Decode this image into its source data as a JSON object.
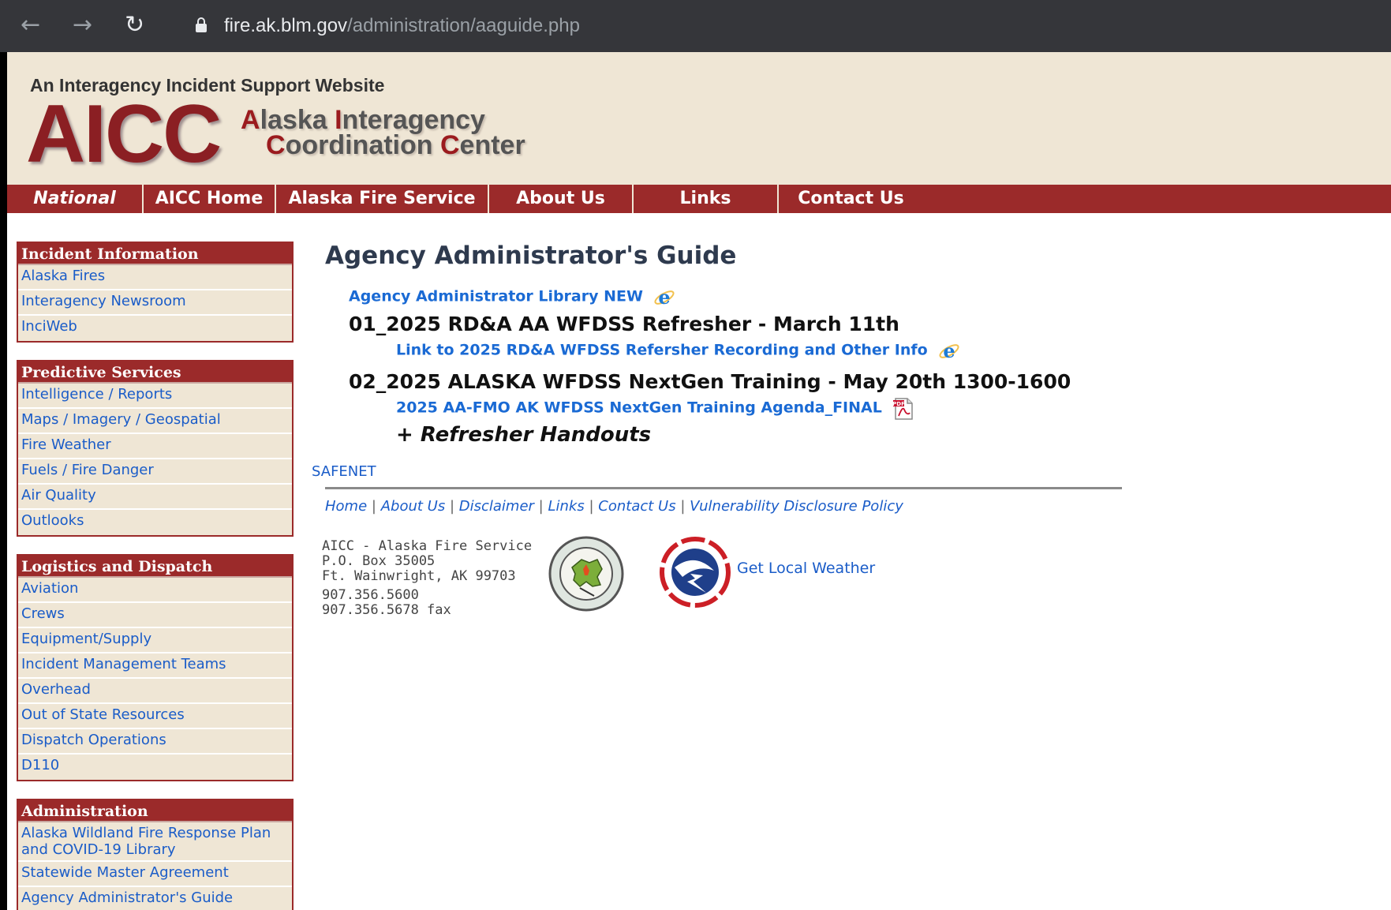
{
  "browser": {
    "url_host": "fire.ak.blm.gov",
    "url_path": "/administration/aaguide.php"
  },
  "header": {
    "tagline": "An Interagency Incident Support Website",
    "logo_text": "AICC",
    "org_line1_a": "A",
    "org_line1_b": "laska ",
    "org_line1_c": "I",
    "org_line1_d": "nteragency",
    "org_line2_a": "C",
    "org_line2_b": "oordination ",
    "org_line2_c": "C",
    "org_line2_d": "enter"
  },
  "menu": [
    "National",
    "AICC Home",
    "Alaska Fire Service",
    "About Us",
    "Links",
    "Contact Us"
  ],
  "sidebar": [
    {
      "title": "Incident Information",
      "items": [
        "Alaska Fires",
        "Interagency Newsroom",
        "InciWeb"
      ]
    },
    {
      "title": "Predictive Services",
      "items": [
        "Intelligence / Reports",
        "Maps / Imagery / Geospatial",
        "Fire Weather",
        "Fuels / Fire Danger",
        "Air Quality",
        "Outlooks"
      ]
    },
    {
      "title": "Logistics and Dispatch",
      "items": [
        "Aviation",
        "Crews",
        "Equipment/Supply",
        "Incident Management Teams",
        "Overhead",
        "Out of State Resources",
        "Dispatch Operations",
        "D110"
      ]
    },
    {
      "title": "Administration",
      "items": [
        "Alaska Wildland Fire Response Plan and COVID-19 Library",
        "Statewide Master Agreement",
        "Agency Administrator's Guide"
      ]
    }
  ],
  "main": {
    "title": "Agency Administrator's Guide",
    "library_link": "Agency Administrator Library NEW",
    "section1_title": "01_2025 RD&A AA WFDSS Refresher - March 11th",
    "section1_link": "Link to 2025 RD&A WFDSS Refersher Recording and Other Info",
    "section2_title": "02_2025 ALASKA WFDSS NextGen Training - May 20th 1300-1600",
    "section2_link": "2025 AA-FMO AK WFDSS NextGen Training Agenda_FINAL",
    "refresher": "+ Refresher Handouts",
    "safenet": "SAFENET"
  },
  "footer": {
    "links": [
      "Home",
      "About Us",
      "Disclaimer",
      "Links",
      "Contact Us",
      "Vulnerability Disclosure Policy"
    ],
    "separator": "|",
    "address_line1": "AICC - Alaska Fire Service",
    "address_line2": "P.O. Box 35005",
    "address_line3": "Ft. Wainwright, AK 99703",
    "phone": "907.356.5600",
    "fax": "907.356.5678 fax",
    "weather_link": "Get Local Weather"
  },
  "colors": {
    "brand_red": "#9b2a2a",
    "header_bg": "#efe6d5",
    "link_blue": "#1a5cc8"
  }
}
